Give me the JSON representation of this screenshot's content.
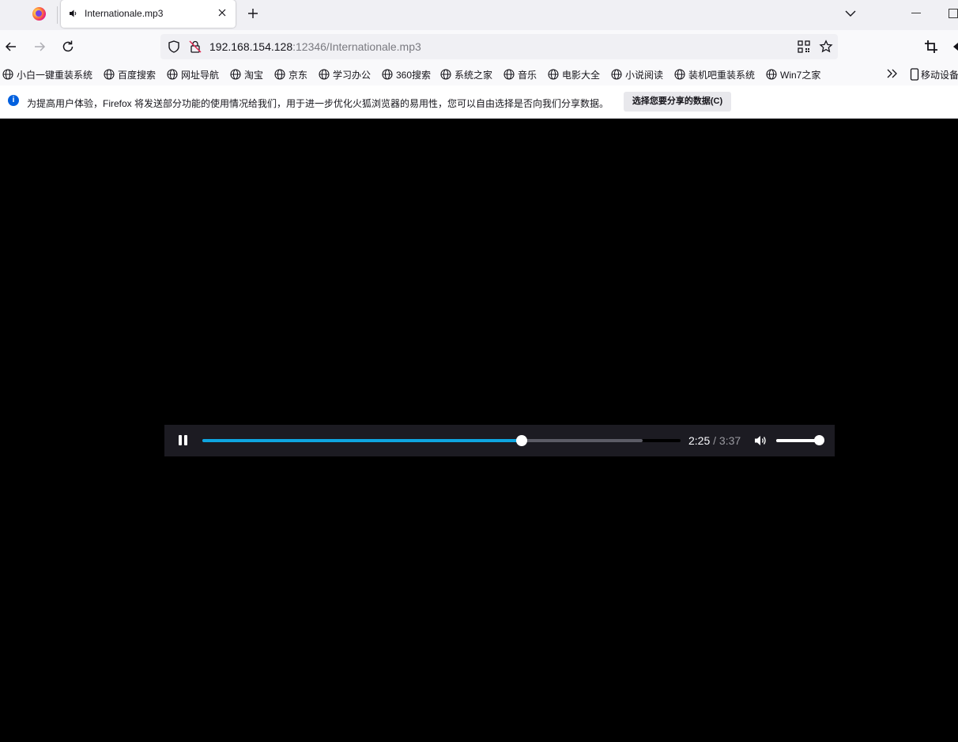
{
  "window": {
    "tab_title": "Internationale.mp3"
  },
  "urlbar": {
    "host": "192.168.154.128",
    "rest": ":12346/Internationale.mp3"
  },
  "bookmarks": [
    {
      "label": "小白一键重装系统"
    },
    {
      "label": "百度搜索"
    },
    {
      "label": "网址导航"
    },
    {
      "label": "淘宝"
    },
    {
      "label": "京东"
    },
    {
      "label": "学习办公"
    },
    {
      "label": "360搜索"
    },
    {
      "label": "系统之家"
    },
    {
      "label": "音乐"
    },
    {
      "label": "电影大全"
    },
    {
      "label": "小说阅读"
    },
    {
      "label": "装机吧重装系统"
    },
    {
      "label": "Win7之家"
    }
  ],
  "mobile_bookmarks": "移动设备",
  "notification": {
    "message": "为提高用户体验，Firefox 将发送部分功能的使用情况给我们，用于进一步优化火狐浏览器的易用性，您可以自由选择是否向我们分享数据。",
    "button_label": "选择您要分享的数据(C)"
  },
  "player": {
    "current_time": "2:25",
    "separator": " / ",
    "duration": "3:37",
    "played_fraction": 0.668,
    "buffered_fraction": 0.92,
    "volume_fraction": 1.0
  },
  "colors": {
    "accent": "#0ea5e0",
    "info": "#0060df"
  }
}
